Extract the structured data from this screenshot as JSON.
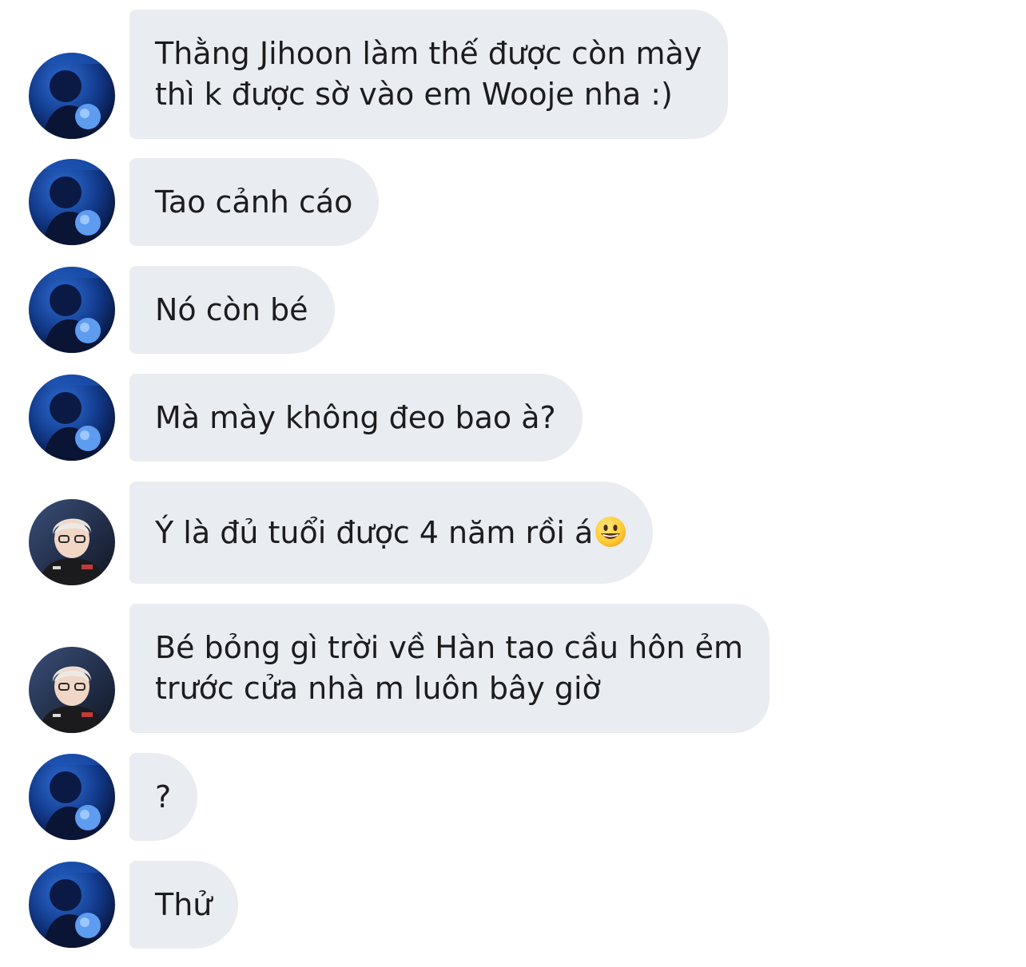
{
  "colors": {
    "bubble_background": "#e9ecf0",
    "text": "#1c1c1e",
    "page_background": "#ffffff"
  },
  "avatars": {
    "a": {
      "icon": "dark-blue-photo-avatar"
    },
    "b": {
      "icon": "blond-person-photo-avatar"
    }
  },
  "messages": [
    {
      "sender": "a",
      "lines": [
        "Thằng Jihoon làm thế được còn mày",
        "thì k được sờ vào em Wooje nha :)"
      ]
    },
    {
      "sender": "a",
      "lines": [
        "Tao cảnh cáo"
      ]
    },
    {
      "sender": "a",
      "lines": [
        "Nó còn bé"
      ]
    },
    {
      "sender": "a",
      "lines": [
        "Mà mày không đeo bao à?"
      ]
    },
    {
      "sender": "b",
      "lines": [
        "Ý là đủ tuổi được 4 năm rồi á"
      ],
      "emoji": "grinning-face-emoji"
    },
    {
      "sender": "b",
      "lines": [
        "Bé bỏng gì trời về Hàn tao cầu hôn ẻm",
        "trước cửa nhà m luôn bây giờ"
      ]
    },
    {
      "sender": "a",
      "lines": [
        "?"
      ]
    },
    {
      "sender": "a",
      "lines": [
        "Thử"
      ]
    }
  ]
}
